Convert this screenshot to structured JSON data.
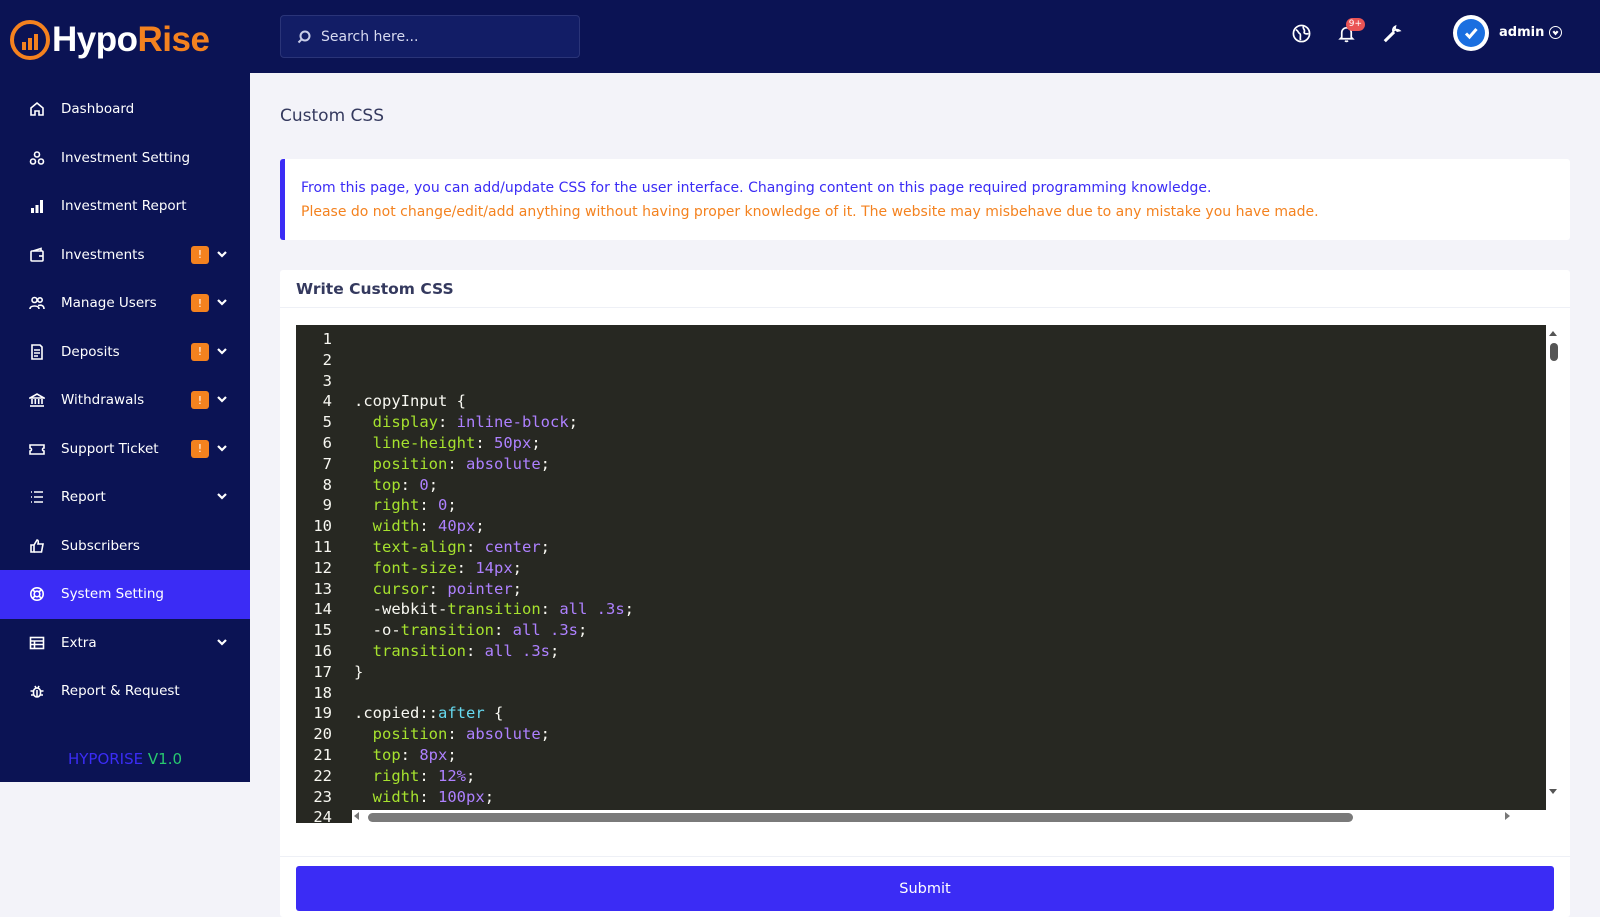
{
  "brand": {
    "part1": "Hypo",
    "part2": "Rise"
  },
  "search": {
    "placeholder": "Search here..."
  },
  "topbar": {
    "notification_count": "9+",
    "admin_name": "admin"
  },
  "sidebar": {
    "items": [
      {
        "label": "Dashboard",
        "icon": "home-icon"
      },
      {
        "label": "Investment Setting",
        "icon": "investment-setting-icon"
      },
      {
        "label": "Investment Report",
        "icon": "bar-chart-icon"
      },
      {
        "label": "Investments",
        "icon": "wallet-icon",
        "badge": "!",
        "has_dropdown": true
      },
      {
        "label": "Manage Users",
        "icon": "users-icon",
        "badge": "!",
        "has_dropdown": true
      },
      {
        "label": "Deposits",
        "icon": "invoice-icon",
        "badge": "!",
        "has_dropdown": true
      },
      {
        "label": "Withdrawals",
        "icon": "bank-icon",
        "badge": "!",
        "has_dropdown": true
      },
      {
        "label": "Support Ticket",
        "icon": "ticket-icon",
        "badge": "!",
        "has_dropdown": true
      },
      {
        "label": "Report",
        "icon": "list-icon",
        "has_dropdown": true
      },
      {
        "label": "Subscribers",
        "icon": "thumbs-up-icon"
      },
      {
        "label": "System Setting",
        "icon": "lifebuoy-icon",
        "active": true
      },
      {
        "label": "Extra",
        "icon": "table-icon",
        "has_dropdown": true
      },
      {
        "label": "Report & Request",
        "icon": "bug-icon"
      }
    ],
    "version": {
      "name": "HYPORISE",
      "number": "V1.0"
    }
  },
  "page": {
    "title": "Custom CSS",
    "alert_line1": "From this page, you can add/update CSS for the user interface. Changing content on this page required programming knowledge.",
    "alert_line2": "Please do not change/edit/add anything without having proper knowledge of it. The website may misbehave due to any mistake you have made.",
    "card_title": "Write Custom CSS",
    "submit_label": "Submit"
  },
  "editor": {
    "lines": [
      {
        "n": "1",
        "code": ""
      },
      {
        "n": "2",
        "code": ""
      },
      {
        "n": "3",
        "code": ""
      },
      {
        "n": "4",
        "code": ".copyInput {"
      },
      {
        "n": "5",
        "code": "  display: inline-block;"
      },
      {
        "n": "6",
        "code": "  line-height: 50px;"
      },
      {
        "n": "7",
        "code": "  position: absolute;"
      },
      {
        "n": "8",
        "code": "  top: 0;"
      },
      {
        "n": "9",
        "code": "  right: 0;"
      },
      {
        "n": "10",
        "code": "  width: 40px;"
      },
      {
        "n": "11",
        "code": "  text-align: center;"
      },
      {
        "n": "12",
        "code": "  font-size: 14px;"
      },
      {
        "n": "13",
        "code": "  cursor: pointer;"
      },
      {
        "n": "14",
        "code": "  -webkit-transition: all .3s;"
      },
      {
        "n": "15",
        "code": "  -o-transition: all .3s;"
      },
      {
        "n": "16",
        "code": "  transition: all .3s;"
      },
      {
        "n": "17",
        "code": "}"
      },
      {
        "n": "18",
        "code": ""
      },
      {
        "n": "19",
        "code": ".copied::after {"
      },
      {
        "n": "20",
        "code": "  position: absolute;"
      },
      {
        "n": "21",
        "code": "  top: 8px;"
      },
      {
        "n": "22",
        "code": "  right: 12%;"
      },
      {
        "n": "23",
        "code": "  width: 100px;"
      },
      {
        "n": "24",
        "code": ""
      }
    ]
  },
  "colors": {
    "sidebar_bg": "#0b1354",
    "accent": "#3b2cf5",
    "warning": "#f4821f",
    "success": "#28c76f",
    "editor_bg": "#272822"
  }
}
